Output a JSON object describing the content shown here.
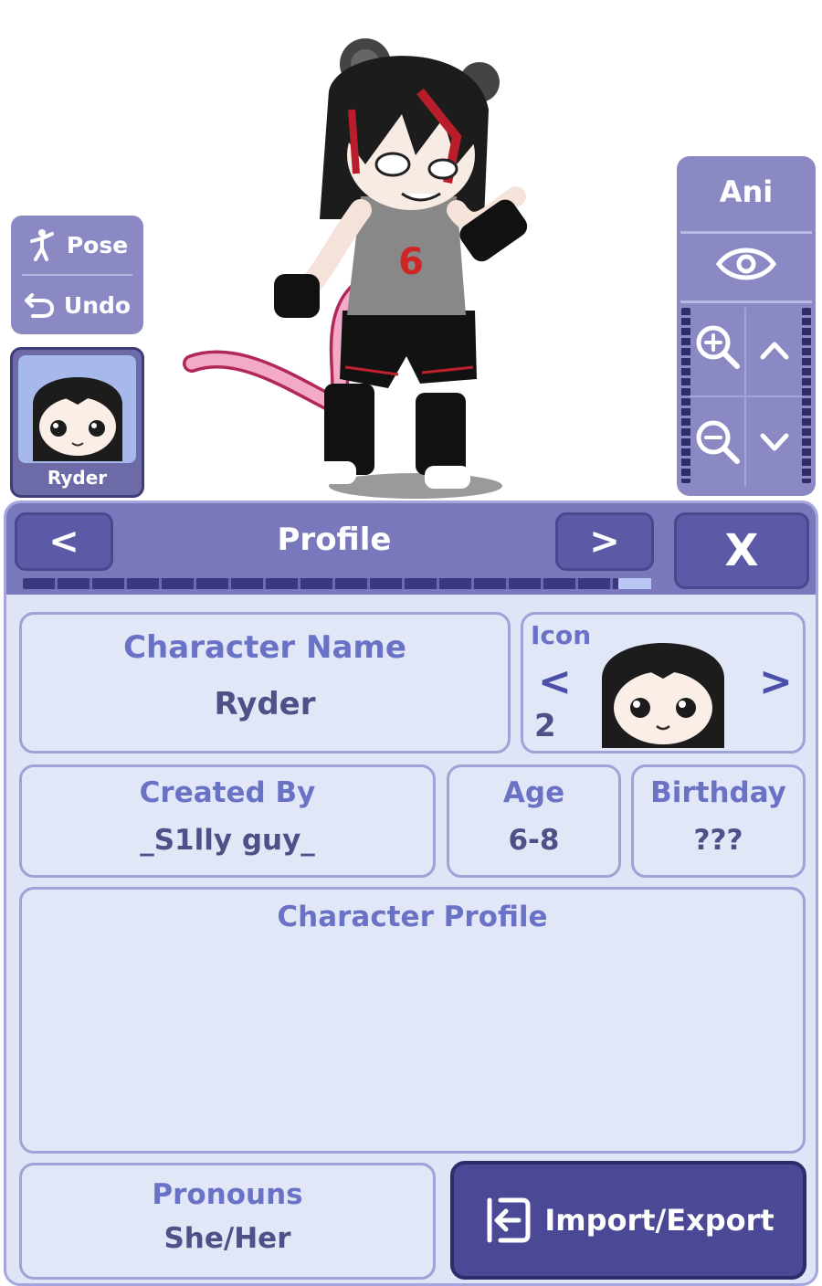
{
  "left_controls": {
    "pose_label": "Pose",
    "undo_label": "Undo",
    "character_card_name": "Ryder"
  },
  "right_controls": {
    "ani_label": "Ani"
  },
  "profile_panel": {
    "title": "Profile",
    "prev_label": "<",
    "next_label": ">",
    "close_label": "X",
    "character_name": {
      "title": "Character Name",
      "value": "Ryder"
    },
    "icon": {
      "title": "Icon",
      "number": "2",
      "prev": "<",
      "next": ">"
    },
    "created_by": {
      "title": "Created By",
      "value": "_S1lly guy_"
    },
    "age": {
      "title": "Age",
      "value": "6-8"
    },
    "birthday": {
      "title": "Birthday",
      "value": "???"
    },
    "character_profile": {
      "title": "Character Profile",
      "value": ""
    },
    "pronouns": {
      "title": "Pronouns",
      "value": "She/Her"
    },
    "import_export_label": "Import/Export"
  },
  "colors": {
    "panel_header": "#7a78bd",
    "panel_bg": "#dfe4f7",
    "title_text": "#6a72c6",
    "value_text": "#4e5187",
    "button_dark": "#4b4896"
  }
}
